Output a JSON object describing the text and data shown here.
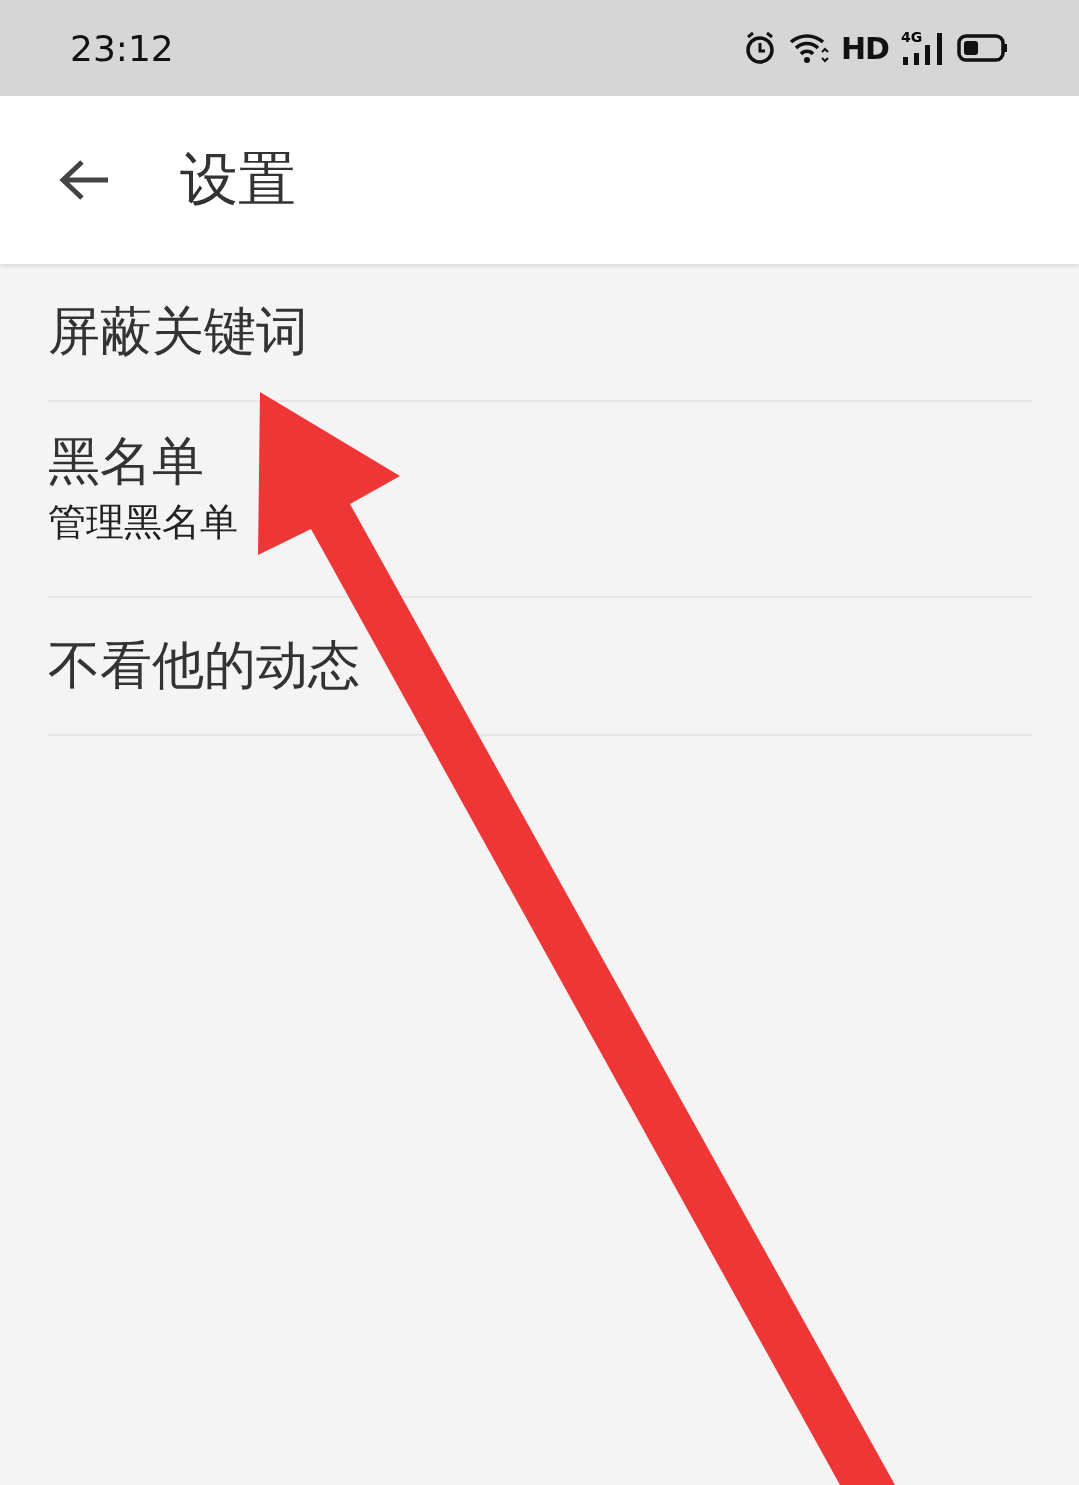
{
  "status_bar": {
    "time": "23:12",
    "hd": "HD",
    "network": "4G"
  },
  "header": {
    "title": "设置"
  },
  "items": [
    {
      "title": "屏蔽关键词"
    },
    {
      "title": "黑名单",
      "subtitle": "管理黑名单"
    },
    {
      "title": "不看他的动态"
    }
  ]
}
